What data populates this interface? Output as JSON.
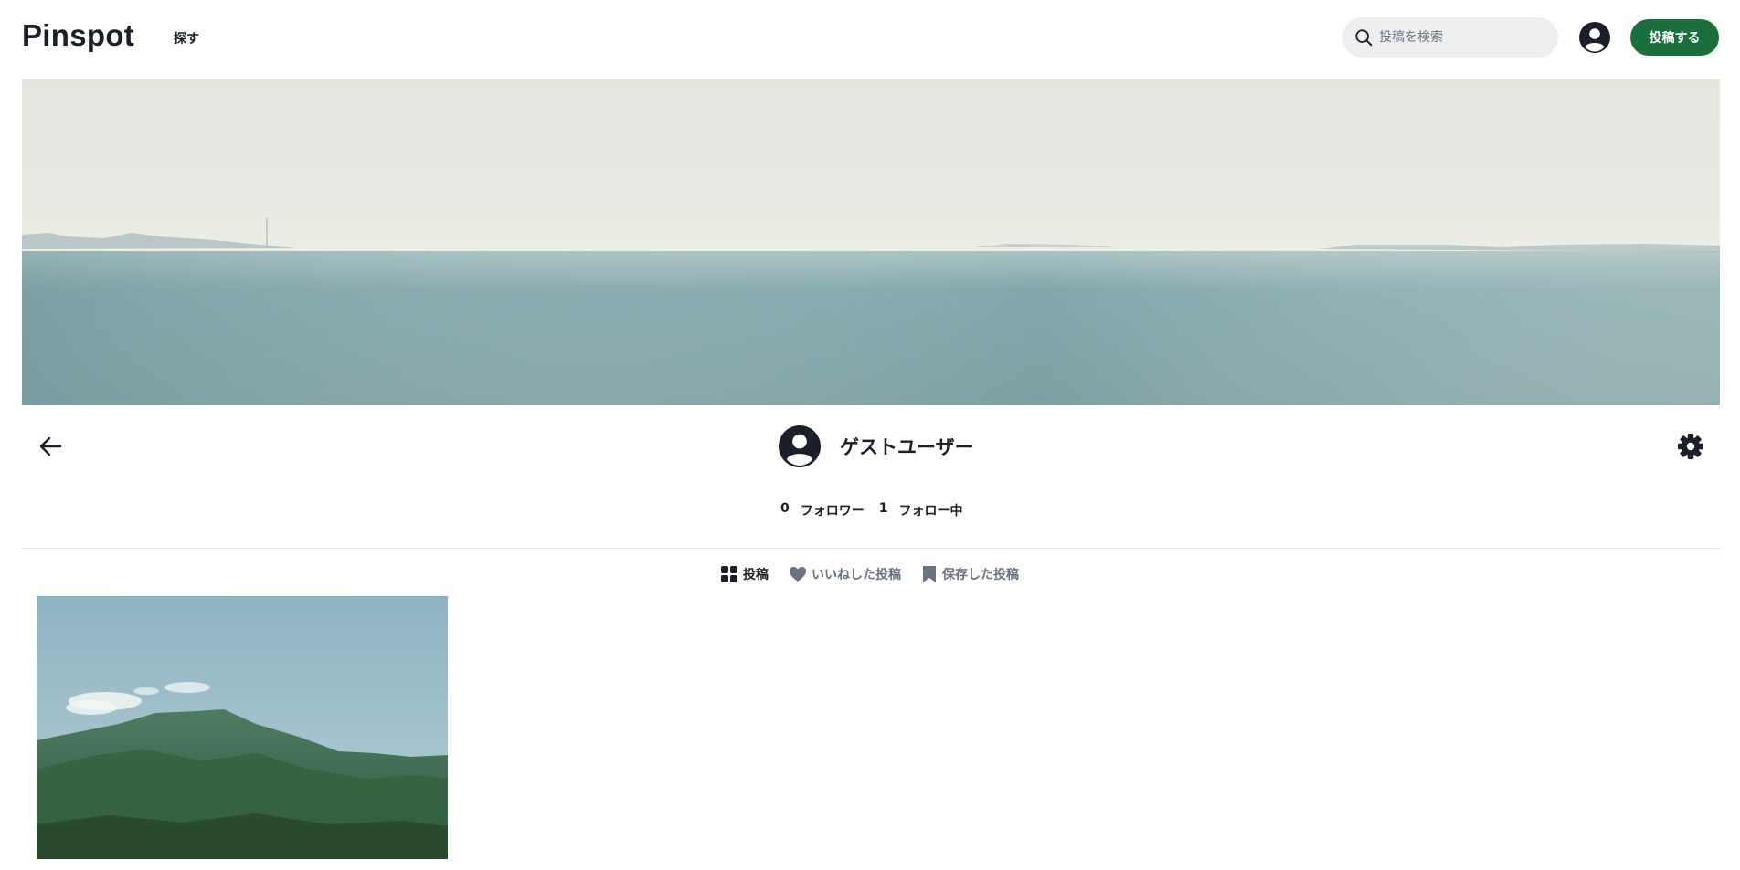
{
  "header": {
    "logo": "Pinspot",
    "explore_label": "探す",
    "search_placeholder": "投稿を検索",
    "post_button_label": "投稿する"
  },
  "profile": {
    "name": "ゲストユーザー",
    "followers_count": "0",
    "followers_label": "フォロワー",
    "following_count": "1",
    "following_label": "フォロー中"
  },
  "tabs": [
    {
      "label": "投稿",
      "icon": "grid-icon",
      "active": true
    },
    {
      "label": "いいねした投稿",
      "icon": "heart-icon",
      "active": false
    },
    {
      "label": "保存した投稿",
      "icon": "bookmark-icon",
      "active": false
    }
  ],
  "colors": {
    "brand_green": "#1b6f3d",
    "text_dark": "#1b1f27",
    "muted": "#6b7280",
    "search_bg": "#eceef0"
  },
  "icons": {
    "search": "search-icon",
    "account": "user-circle-icon",
    "back": "arrow-left-icon",
    "settings": "gear-icon"
  }
}
